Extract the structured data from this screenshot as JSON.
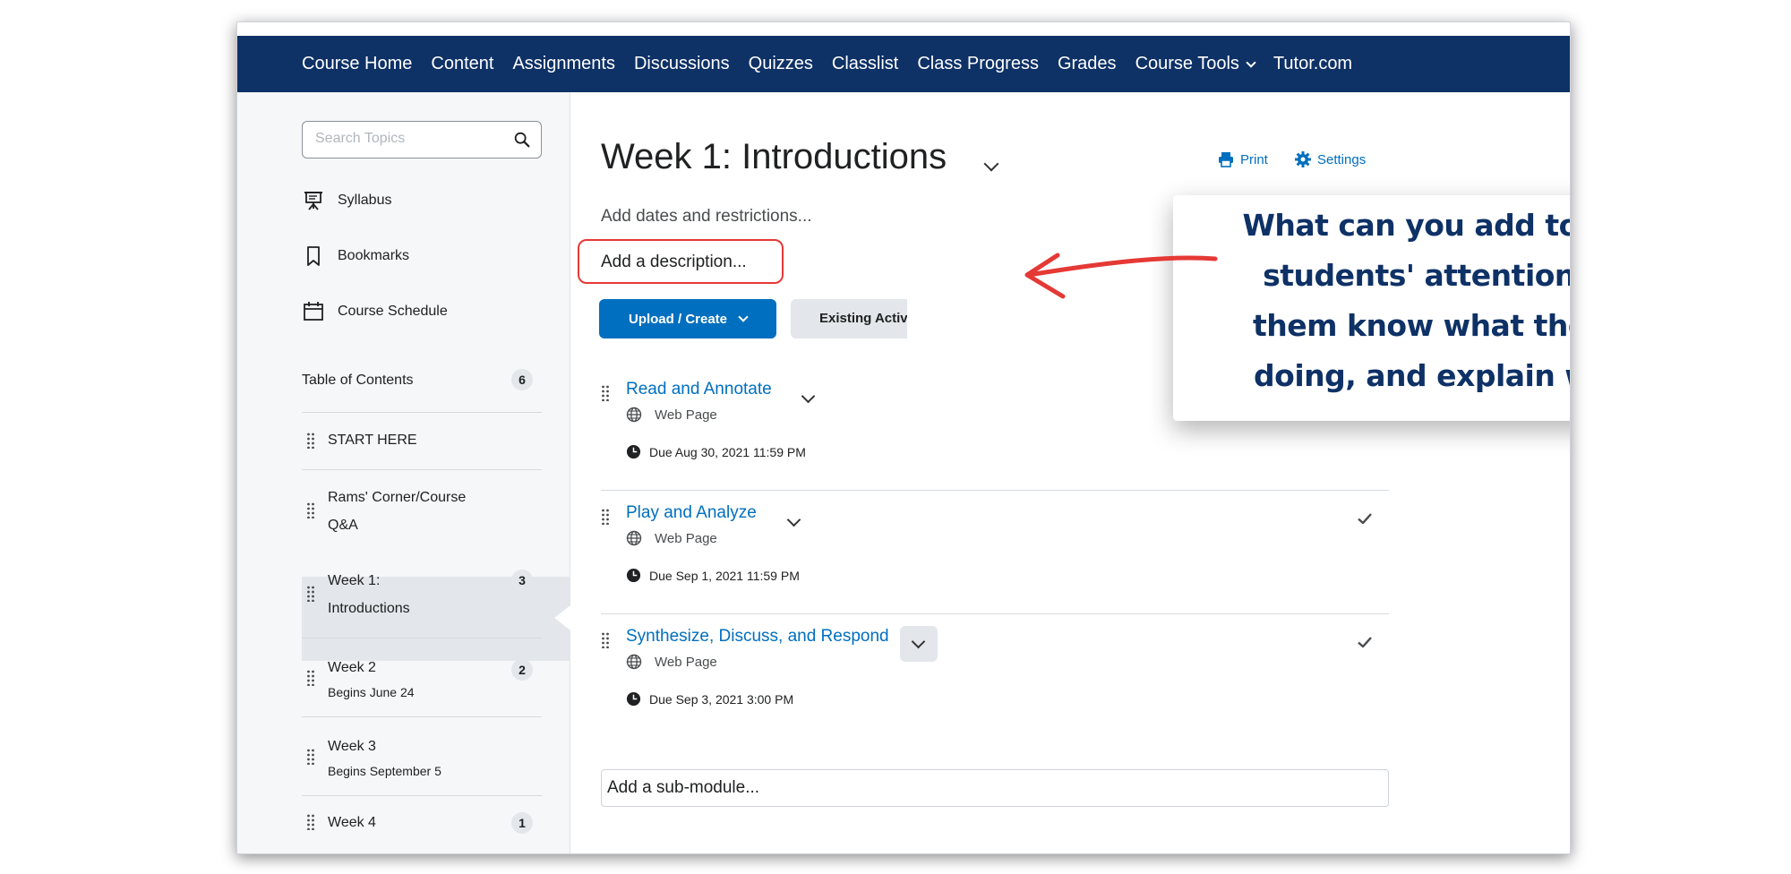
{
  "nav": {
    "items": [
      "Course Home",
      "Content",
      "Assignments",
      "Discussions",
      "Quizzes",
      "Classlist",
      "Class Progress",
      "Grades",
      "Course Tools",
      "Tutor.com"
    ]
  },
  "sidebar": {
    "search_placeholder": "Search Topics",
    "links": {
      "syllabus": "Syllabus",
      "bookmarks": "Bookmarks",
      "course_schedule": "Course Schedule"
    },
    "toc": {
      "title": "Table of Contents",
      "count": "6",
      "items": [
        {
          "label": "START HERE"
        },
        {
          "label_line1": "Rams' Corner/Course",
          "label_line2": "Q&A"
        },
        {
          "label_line1": "Week 1:",
          "label_line2": "Introductions",
          "count": "3"
        },
        {
          "label": "Week 2",
          "sub": "Begins June 24",
          "count": "2"
        },
        {
          "label": "Week 3",
          "sub": "Begins September 5"
        },
        {
          "label": "Week 4",
          "count": "1"
        }
      ]
    }
  },
  "main": {
    "title": "Week 1: Introductions",
    "print_label": "Print",
    "settings_label": "Settings",
    "add_dates": "Add dates and restrictions...",
    "add_description": "Add a description...",
    "upload_button": "Upload / Create",
    "existing_button": "Existing Activities",
    "activities": [
      {
        "title": "Read and Annotate",
        "type": "Web Page",
        "due": "Due Aug 30, 2021 11:59 PM"
      },
      {
        "title": "Play and Analyze",
        "type": "Web Page",
        "due": "Due Sep 1, 2021 11:59 PM"
      },
      {
        "title": "Synthesize, Discuss, and Respond",
        "type": "Web Page",
        "due": "Due Sep 3, 2021 3:00 PM"
      }
    ],
    "add_submodule": "Add a sub-module..."
  },
  "callout": {
    "lines": [
      "What can you add to gain",
      "students' attention, let",
      "them know what they're",
      "doing, and explain why?"
    ]
  },
  "colors": {
    "navbar": "#0e3166",
    "link": "#006fbf",
    "highlight": "#e53935",
    "callout_text": "#0e3166"
  }
}
